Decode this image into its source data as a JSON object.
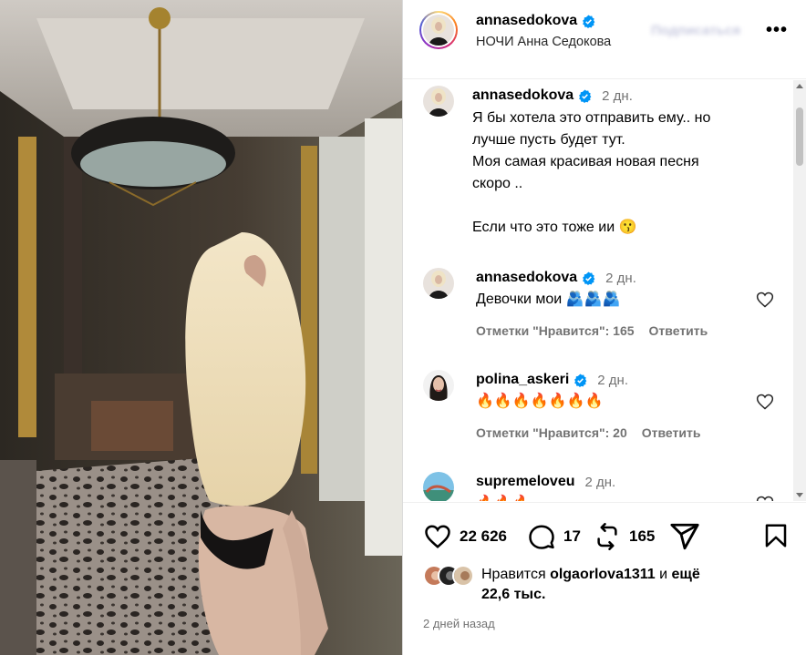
{
  "header": {
    "username": "annasedokova",
    "subtitle": "НОЧИ Анна Седокова",
    "follow_label": "Подписаться",
    "more_label": "•••"
  },
  "caption": {
    "username": "annasedokova",
    "time": "2 дн.",
    "lines": [
      "Я бы хотела это отправить ему.. но",
      "лучше пусть будет тут.",
      "Моя самая красивая новая песня",
      "скоро ..",
      "",
      "Если что это тоже ии 😗"
    ]
  },
  "comments": [
    {
      "username": "annasedokova",
      "time": "2 дн.",
      "text": "Девочки мои 🫂🫂🫂",
      "likes_label": "Отметки \"Нравится\": 165",
      "reply_label": "Ответить"
    },
    {
      "username": "polina_askeri",
      "time": "2 дн.",
      "text": "🔥🔥🔥🔥🔥🔥🔥",
      "likes_label": "Отметки \"Нравится\": 20",
      "reply_label": "Ответить"
    },
    {
      "username": "supremeloveu",
      "time": "2 дн.",
      "text": "🔥🔥🔥"
    }
  ],
  "actions": {
    "like_count": "22 626",
    "comment_count": "17",
    "repost_count": "165"
  },
  "likes": {
    "prefix": "Нравится",
    "user": "olgaorlova1311",
    "middle": "и",
    "suffix": "ещё",
    "rest": "22,6 тыс."
  },
  "post_date": "2 дней назад",
  "colors": {
    "verified": "#0095f6",
    "muted": "#737373",
    "divider": "#efefef"
  }
}
